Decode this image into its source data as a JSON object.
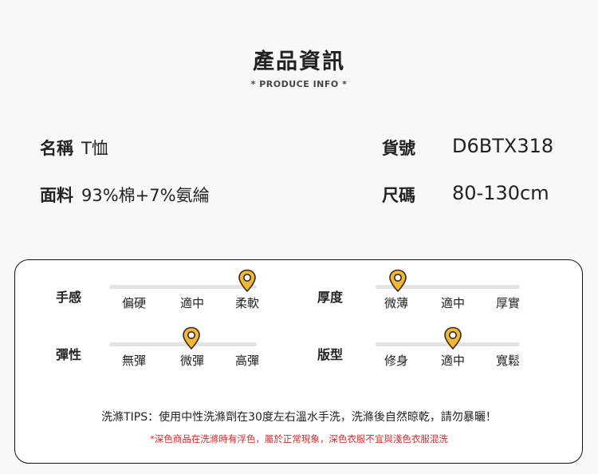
{
  "header": {
    "title": "產品資訊",
    "subtitle": "* PRODUCE INFO *"
  },
  "info": {
    "name_label": "名稱",
    "name_value": "T恤",
    "fabric_label": "面料",
    "fabric_value": "93%棉+7%氨綸",
    "code_label": "貨號",
    "code_value": "D6BTX318",
    "size_label": "尺碼",
    "size_value": "80-130cm"
  },
  "attributes": {
    "feel": {
      "label": "手感",
      "options": [
        "偏硬",
        "適中",
        "柔軟"
      ],
      "selected_index": 2
    },
    "thickness": {
      "label": "厚度",
      "options": [
        "微薄",
        "適中",
        "厚實"
      ],
      "selected_index": 0
    },
    "elasticity": {
      "label": "彈性",
      "options": [
        "無彈",
        "微彈",
        "高彈"
      ],
      "selected_index": 1
    },
    "fit": {
      "label": "版型",
      "options": [
        "修身",
        "適中",
        "寬鬆"
      ],
      "selected_index": 1
    }
  },
  "tips": {
    "text": "洗滌TIPS：使用中性洗滌劑在30度左右溫水手洗，洗滌後自然晾乾，請勿暴曬！",
    "warning": "*深色商品在洗滌時有浮色，屬於正常現象，深色衣服不宜與淺色衣服混洗"
  },
  "colors": {
    "pin_fill": "#f5b731",
    "pin_stroke": "#2b2b2b",
    "warning": "#e0282a"
  },
  "icons": {
    "pin": "map-pin-icon"
  }
}
